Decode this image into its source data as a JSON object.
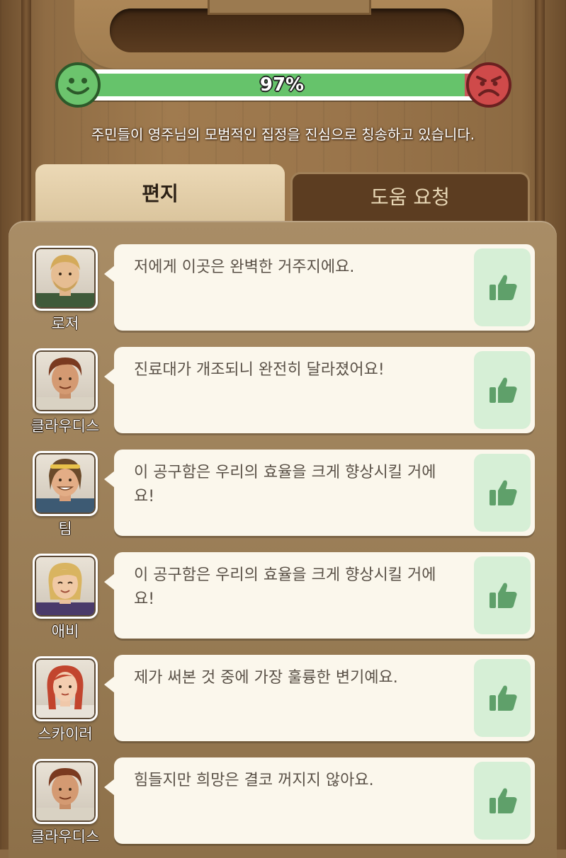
{
  "satisfaction": {
    "percent_label": "97%",
    "value": 0.97,
    "message": "주민들이 영주님의 모범적인 집정을 진심으로 칭송하고 있습니다."
  },
  "tabs": {
    "letters": "편지",
    "help": "도움 요청"
  },
  "letters": [
    {
      "name": "로저",
      "text": "저에게 이곳은 완벽한 거주지에요."
    },
    {
      "name": "클라우디스",
      "text": "진료대가 개조되니 완전히 달라졌어요!"
    },
    {
      "name": "팀",
      "text": "이 공구함은 우리의 효율을 크게 향상시킬 거에요!"
    },
    {
      "name": "애비",
      "text": "이 공구함은 우리의 효율을 크게 향상시킬 거에요!"
    },
    {
      "name": "스카이러",
      "text": "제가 써본 것 중에 가장 훌륭한 변기예요."
    },
    {
      "name": "클라우디스",
      "text": "힘들지만 희망은 결코 꺼지지 않아요."
    }
  ],
  "colors": {
    "meter_fill": "#66c36b",
    "meter_empty": "#c9575b",
    "like_bg": "#d6efd6",
    "like_icon": "#5fa06a"
  },
  "icons": {
    "happy": "happy-face-icon",
    "sad": "sad-face-icon",
    "like": "thumbs-up-icon"
  }
}
